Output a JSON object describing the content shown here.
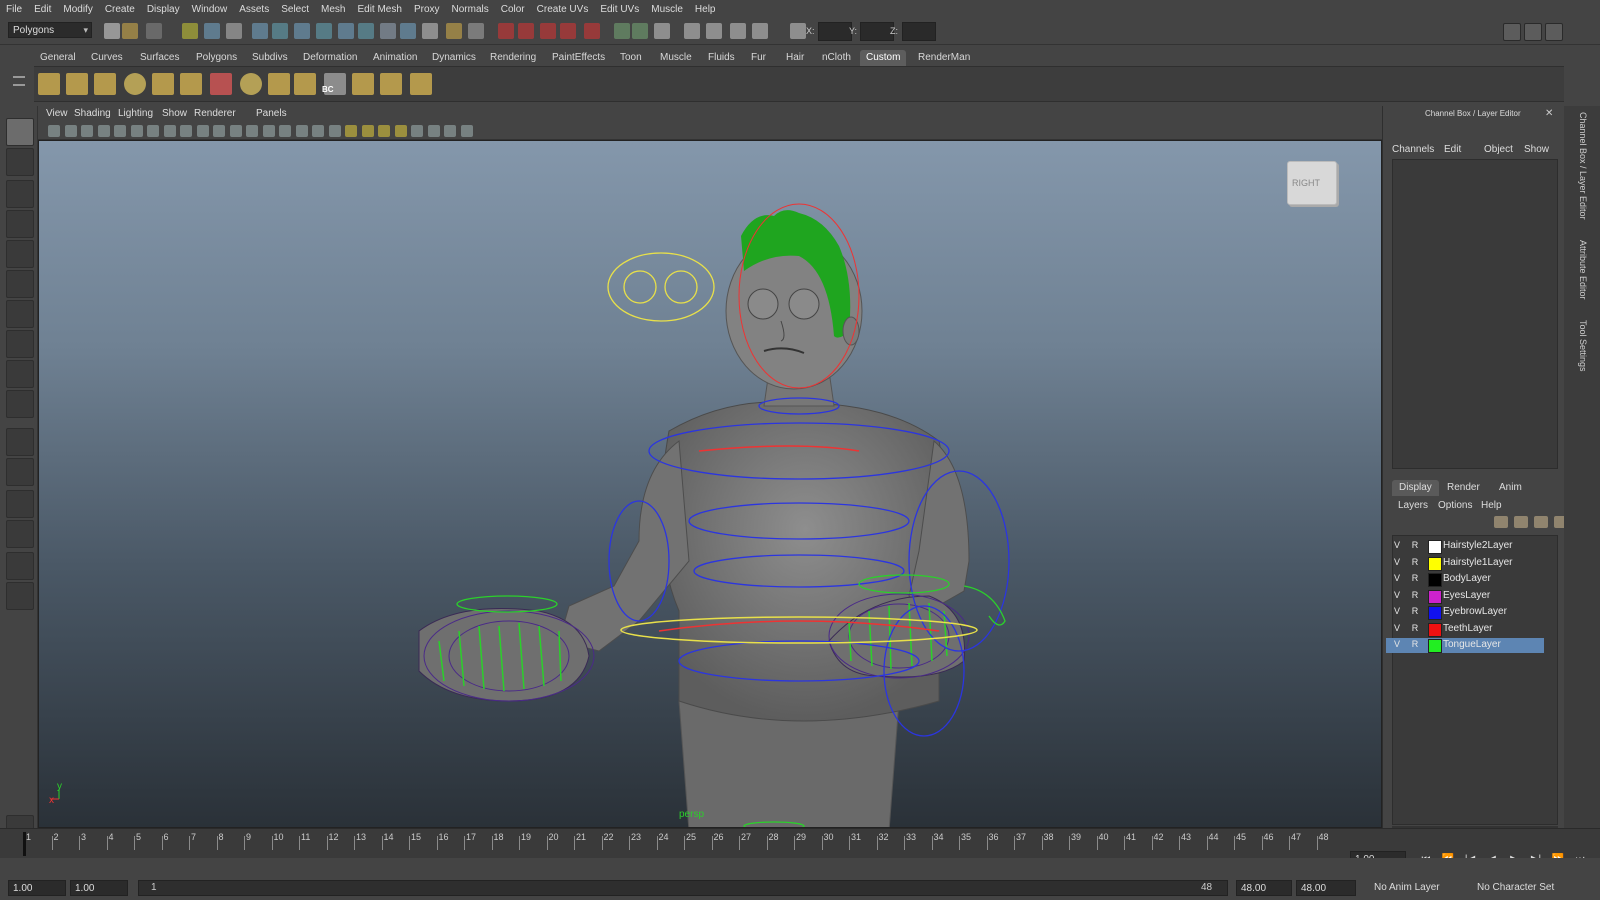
{
  "menubar": [
    "File",
    "Edit",
    "Modify",
    "Create",
    "Display",
    "Window",
    "Assets",
    "Select",
    "Mesh",
    "Edit Mesh",
    "Proxy",
    "Normals",
    "Color",
    "Create UVs",
    "Edit UVs",
    "Muscle",
    "Help"
  ],
  "statusline": {
    "mode": "Polygons",
    "x_label": "X:",
    "y_label": "Y:",
    "z_label": "Z:"
  },
  "shelf_tabs": [
    "General",
    "Curves",
    "Surfaces",
    "Polygons",
    "Subdivs",
    "Deformation",
    "Animation",
    "Dynamics",
    "Rendering",
    "PaintEffects",
    "Toon",
    "Muscle",
    "Fluids",
    "Fur",
    "Hair",
    "nCloth",
    "Custom",
    "RenderMan"
  ],
  "shelf_icon_label": "BC",
  "viewport": {
    "menu": [
      "View",
      "Shading",
      "Lighting",
      "Show",
      "Renderer",
      "Panels"
    ],
    "camera_label": "persp",
    "viewcube_label": "RIGHT",
    "axis_x": "x",
    "axis_y": "y"
  },
  "channelbox": {
    "title": "Channel Box / Layer Editor",
    "menu": [
      "Channels",
      "Edit",
      "Object",
      "Show"
    ],
    "layer_tabs": [
      "Display",
      "Render",
      "Anim"
    ],
    "layer_menu": [
      "Layers",
      "Options",
      "Help"
    ],
    "layers": [
      {
        "v": "V",
        "r": "R",
        "color": "#ffffff",
        "name": "Hairstyle2Layer",
        "selected": false
      },
      {
        "v": "V",
        "r": "R",
        "color": "#ffff00",
        "name": "Hairstyle1Layer",
        "selected": false
      },
      {
        "v": "V",
        "r": "R",
        "color": "#000000",
        "name": "BodyLayer",
        "selected": false
      },
      {
        "v": "V",
        "r": "R",
        "color": "#cc22cc",
        "name": "EyesLayer",
        "selected": false
      },
      {
        "v": "V",
        "r": "R",
        "color": "#1111ee",
        "name": "EyebrowLayer",
        "selected": false
      },
      {
        "v": "V",
        "r": "R",
        "color": "#ee1111",
        "name": "TeethLayer",
        "selected": false
      },
      {
        "v": "V",
        "r": "R",
        "color": "#22ee22",
        "name": "TongueLayer",
        "selected": true
      }
    ]
  },
  "side_tabs": [
    "Channel Box / Layer Editor",
    "Attribute Editor",
    "Tool Settings"
  ],
  "timeline": {
    "ticks": [
      "1",
      "2",
      "3",
      "4",
      "5",
      "6",
      "7",
      "8",
      "9",
      "10",
      "11",
      "12",
      "13",
      "14",
      "15",
      "16",
      "17",
      "18",
      "19",
      "20",
      "21",
      "22",
      "23",
      "24",
      "25",
      "26",
      "27",
      "28",
      "29",
      "30",
      "31",
      "32",
      "33",
      "34",
      "35",
      "36",
      "37",
      "38",
      "39",
      "40",
      "41",
      "42",
      "43",
      "44",
      "45",
      "46",
      "47",
      "48"
    ],
    "current_frame": "1.00"
  },
  "range": {
    "start_time": "1.00",
    "start_range": "1.00",
    "slider_start": "1",
    "slider_end": "48",
    "end_range": "48.00",
    "end_time": "48.00",
    "anim_layer": "No Anim Layer",
    "character_set": "No Character Set"
  }
}
